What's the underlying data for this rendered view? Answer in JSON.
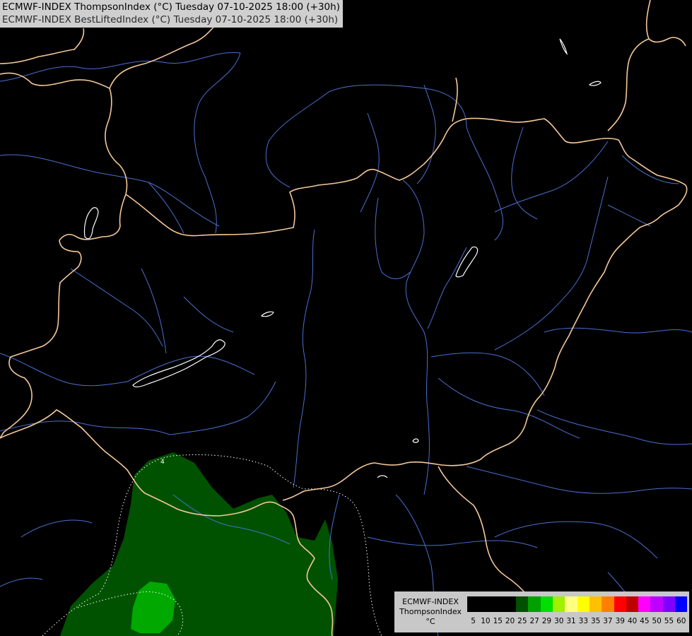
{
  "title": {
    "line1": "ECMWF-INDEX ThompsonIndex (°C) Tuesday 07-10-2025 18:00 (+30h)",
    "line2": "ECMWF-INDEX BestLiftedIndex (°C) Tuesday 07-10-2025 18:00 (+30h)"
  },
  "contour_label": "4",
  "legend": {
    "line1": "ECMWF-INDEX",
    "line2": "ThompsonIndex",
    "line3": "°C",
    "colors": [
      "#000000",
      "#000000",
      "#000000",
      "#000000",
      "#005000",
      "#00a000",
      "#00e000",
      "#a0f000",
      "#ffff80",
      "#ffff00",
      "#ffc000",
      "#ff8000",
      "#ff0000",
      "#c00000",
      "#ff00ff",
      "#c000ff",
      "#8000ff",
      "#0000ff"
    ],
    "ticks": [
      "5",
      "10",
      "15",
      "20",
      "25",
      "27",
      "29",
      "30",
      "31",
      "33",
      "35",
      "37",
      "39",
      "40",
      "45",
      "50",
      "55",
      "60"
    ]
  },
  "colors": {
    "border": "#f4c898",
    "river": "#4a6fd0",
    "lake": "#ffffff",
    "contour": "#ffffff",
    "fill_dark_green": "#005000",
    "fill_green": "#00a000"
  }
}
